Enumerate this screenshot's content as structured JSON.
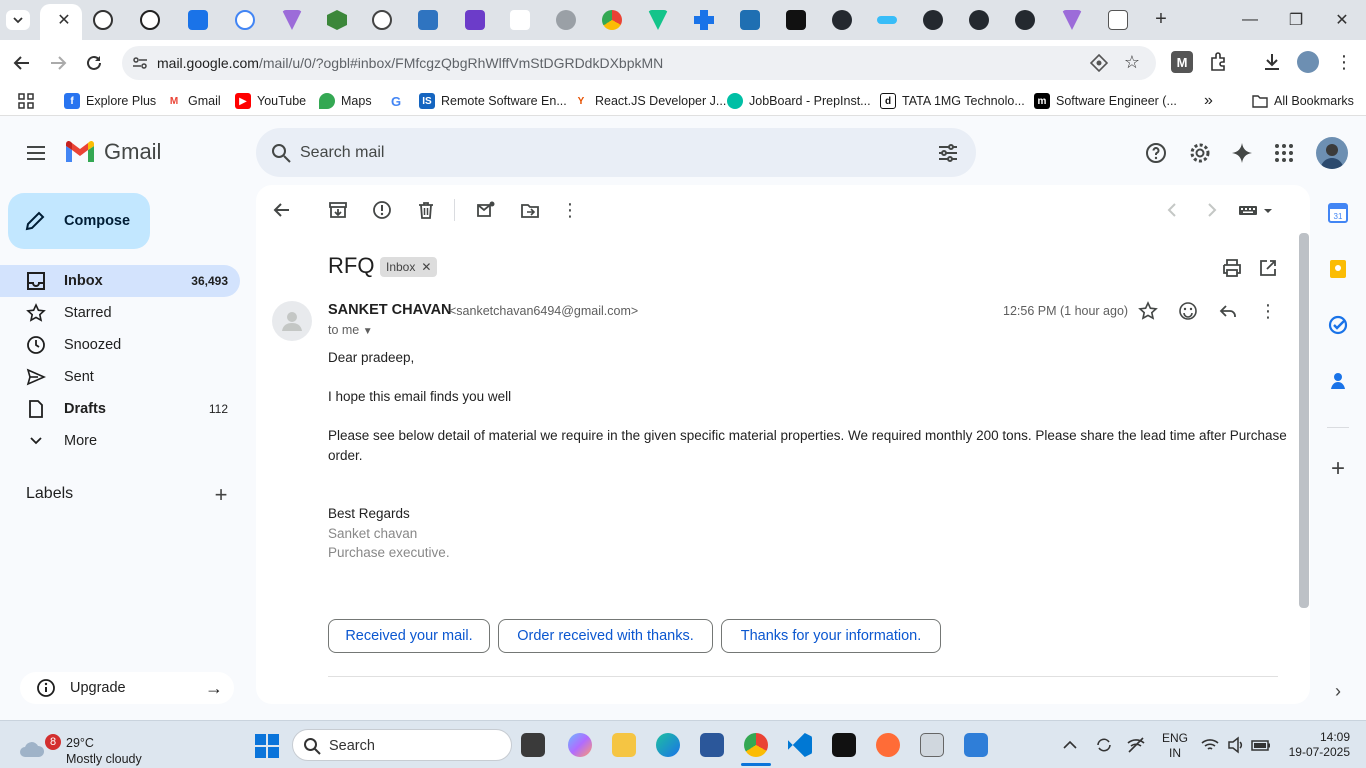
{
  "browser": {
    "url_host": "mail.google.com",
    "url_path": "/mail/u/0/?ogbl#inbox/FMfcgzQbgRhWlffVmStDGRDdkDXbpkMN",
    "bookmarks": [
      {
        "label": "Explore Plus",
        "color": "#f7c600"
      },
      {
        "label": "Gmail",
        "color": "#ea4335"
      },
      {
        "label": "YouTube",
        "color": "#ff0000"
      },
      {
        "label": "Maps",
        "color": "#34a853"
      },
      {
        "label": "",
        "color": "#4285f4"
      },
      {
        "label": "Remote Software En...",
        "color": "#1565c0"
      },
      {
        "label": "React.JS Developer J...",
        "color": "#e65100"
      },
      {
        "label": "JobBoard - PrepInst...",
        "color": "#00bfa5"
      },
      {
        "label": "TATA 1MG Technolo...",
        "color": "#222222"
      },
      {
        "label": "Software Engineer (...",
        "color": "#000000"
      }
    ],
    "all_bookmarks": "All Bookmarks"
  },
  "gmail": {
    "brand": "Gmail",
    "search_placeholder": "Search mail",
    "compose": "Compose",
    "nav": [
      {
        "label": "Inbox",
        "count": "36,493",
        "icon": "inbox-icon"
      },
      {
        "label": "Starred",
        "count": "",
        "icon": "star-icon"
      },
      {
        "label": "Snoozed",
        "count": "",
        "icon": "clock-icon"
      },
      {
        "label": "Sent",
        "count": "",
        "icon": "send-icon"
      },
      {
        "label": "Drafts",
        "count": "112",
        "icon": "draft-icon"
      },
      {
        "label": "More",
        "count": "",
        "icon": "chevron-down-icon"
      }
    ],
    "labels_heading": "Labels",
    "upgrade": "Upgrade"
  },
  "message": {
    "subject": "RFQ",
    "label_chip": "Inbox",
    "sender_name": "SANKET CHAVAN",
    "sender_email": "<sanketchavan6494@gmail.com>",
    "to": "to me",
    "time": "12:56 PM (1 hour ago)",
    "greeting": "Dear pradeep,",
    "line1": "I hope this email finds you well",
    "line2a": "Please see below detail of material we require in the given specific material properties. We required monthly 200 tons. Please share the lead time after Purchase",
    "line2b": "order.",
    "regards": "Best Regards",
    "sig_name": "Sanket chavan",
    "sig_title": "Purchase executive.",
    "smart_replies": [
      "Received your mail.",
      "Order received with thanks.",
      "Thanks for your information."
    ]
  },
  "taskbar": {
    "weather_badge": "8",
    "temp": "29°C",
    "weather": "Mostly cloudy",
    "search": "Search",
    "lang": "ENG",
    "region": "IN",
    "clock_time": "14:09",
    "clock_date": "19-07-2025"
  }
}
